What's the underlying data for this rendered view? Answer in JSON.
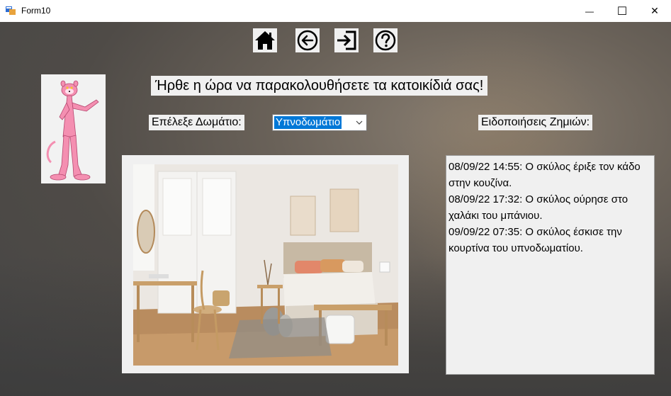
{
  "window": {
    "title": "Form10",
    "minimize_glyph": "—",
    "maximize_glyph": "☐",
    "close_glyph": "✕"
  },
  "toolbar": {
    "icons": [
      "home-icon",
      "back-arrow-icon",
      "exit-icon",
      "help-icon"
    ]
  },
  "heading": "Ήρθε η ώρα να παρακολουθήσετε τα κατοικίδιά σας!",
  "room": {
    "label": "Επέλεξε Δωμάτιο:",
    "selected": "Υπνοδωμάτιο"
  },
  "notifications": {
    "label": "Ειδοποιήσεις Ζημιών:",
    "items": [
      "08/09/22 14:55: Ο σκύλος έριξε τον κάδο στην κουζίνα.",
      "08/09/22 17:32: Ο σκύλος ούρησε στο χαλάκι του μπάνιου.",
      "09/09/22 07:35: Ο σκύλος έσκισε την κουρτίνα του υπνοδωματίου."
    ]
  },
  "colors": {
    "accent": "#0078d7",
    "panel": "#f0f0f0",
    "panther_pink": "#f48fb1"
  }
}
